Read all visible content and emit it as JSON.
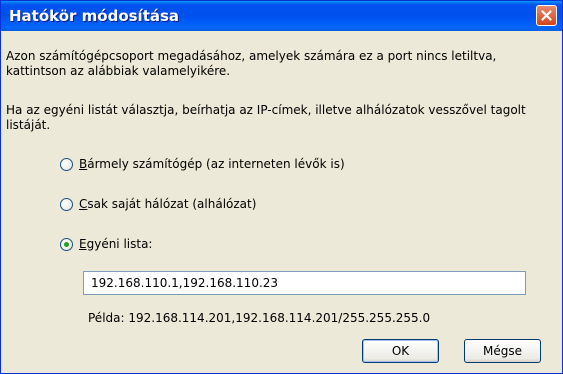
{
  "dialog": {
    "title": "Hatókör módosítása",
    "close_icon": "close-icon"
  },
  "description": {
    "para1": "Azon számítógépcsoport megadásához, amelyek számára ez a port nincs letiltva, kattintson az alábbiak valamelyikére.",
    "para2": "Ha az egyéni listát választja, beírhatja az IP-címek, illetve alhálózatok vesszővel tagolt listáját."
  },
  "options": [
    {
      "mnemonic": "B",
      "rest": "ármely számítógép (az interneten lévők is)",
      "selected": false
    },
    {
      "mnemonic": "C",
      "rest": "sak saját hálózat (alhálózat)",
      "selected": false
    },
    {
      "mnemonic": "E",
      "rest": "gyéni lista:",
      "selected": true
    }
  ],
  "custom_list": {
    "value": "192.168.110.1,192.168.110.23",
    "example": "Példa: 192.168.114.201,192.168.114.201/255.255.255.0"
  },
  "buttons": {
    "ok_label": "OK",
    "cancel_label": "Mégse"
  },
  "colors": {
    "titlebar": "#0053ee",
    "dialog_bg": "#ece9d8",
    "close_button": "#d2431b",
    "radio_dot": "#21a121"
  }
}
